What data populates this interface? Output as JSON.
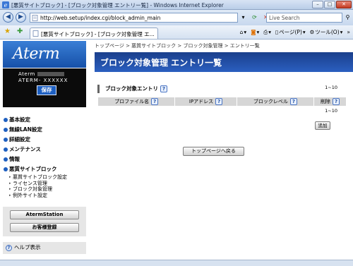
{
  "window": {
    "title": "[悪質サイトブロック] - [ブロック対象管理 エントリー覧] - Windows Internet Explorer",
    "buttons": {
      "minimize": "–",
      "maximize": "□",
      "close": "✕"
    }
  },
  "address_bar": {
    "back_icon": "back-arrow-icon",
    "forward_icon": "forward-arrow-icon",
    "url": "http://web.setup/index.cgi/block_admin_main",
    "search_placeholder": "Live Search"
  },
  "command_bar": {
    "tab_title": "[悪質サイトブロック] - [ブロック対象管理 エ...",
    "page_menu": "ページ(P)",
    "tools_menu": "ツール(O)"
  },
  "sidebar": {
    "logo": "Aterm",
    "model_line1": "Aterm",
    "model_line2": "ATERM- XXXXXX",
    "save_label": "保存",
    "menu": [
      {
        "label": "基本設定"
      },
      {
        "label": "無線LAN設定"
      },
      {
        "label": "詳細設定"
      },
      {
        "label": "メンテナンス"
      },
      {
        "label": "情報"
      },
      {
        "label": "悪質サイトブロック"
      }
    ],
    "submenu": [
      {
        "label": "悪質サイトブロック設定"
      },
      {
        "label": "ライセンス管理"
      },
      {
        "label": "ブロック対象管理"
      },
      {
        "label": "例外サイト設定"
      }
    ],
    "aterm_station_label": "AtermStation",
    "customer_reg_label": "お客様登録",
    "help_label": "ヘルプ表示"
  },
  "main": {
    "breadcrumb": "トップページ > 悪質サイトブロック > ブロック対象管理 > エントリ一覧",
    "page_title": "ブロック対象管理 エントリ一覧",
    "section_title": "ブロック対象エントリ",
    "count_top": "1~10",
    "count_bottom": "1~10",
    "table_headers": [
      "プロファイル名",
      "IPアドレス",
      "ブロックレベル",
      "削除"
    ],
    "add_label": "追加",
    "back_label": "トップページへ戻る"
  }
}
